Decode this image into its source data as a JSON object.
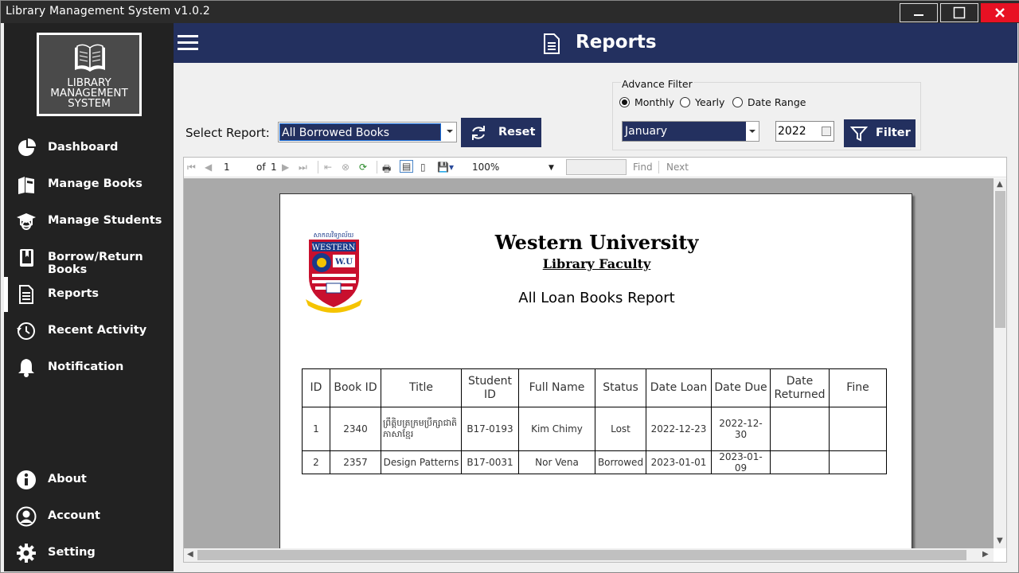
{
  "window": {
    "title": "Library Management System v1.0.2"
  },
  "sidebar": {
    "logo_lines": [
      "LIBRARY",
      "MANAGEMENT",
      "SYSTEM"
    ],
    "items": [
      {
        "label": "Dashboard",
        "icon": "pie-chart-icon"
      },
      {
        "label": "Manage Books",
        "icon": "books-icon"
      },
      {
        "label": "Manage Students",
        "icon": "graduation-cap-icon"
      },
      {
        "label": "Borrow/Return Books",
        "icon": "book-icon"
      },
      {
        "label": "Reports",
        "icon": "document-icon",
        "active": true
      },
      {
        "label": "Recent Activity",
        "icon": "history-icon"
      },
      {
        "label": "Notification",
        "icon": "bell-icon"
      }
    ],
    "bottom_items": [
      {
        "label": "About",
        "icon": "info-icon"
      },
      {
        "label": "Account",
        "icon": "user-icon"
      },
      {
        "label": "Setting",
        "icon": "gear-icon"
      }
    ]
  },
  "header": {
    "title": "Reports"
  },
  "controls": {
    "select_label": "Select Report:",
    "selected_report": "All Borrowed Books",
    "reset_label": "Reset",
    "advance_filter": "Advance Filter",
    "radios": [
      "Monthly",
      "Yearly",
      "Date Range"
    ],
    "radio_selected": "Monthly",
    "month": "January",
    "year": "2022",
    "filter_label": "Filter"
  },
  "toolbar": {
    "page": "1",
    "of_label": "of",
    "total_pages": "1",
    "zoom": "100%",
    "find_label": "Find",
    "next_label": "Next"
  },
  "report": {
    "university": "Western University",
    "faculty": "Library Faculty",
    "title": "All Loan Books Report",
    "seal_text": "WESTERN",
    "seal_abbr": "W.U",
    "columns": [
      "ID",
      "Book ID",
      "Title",
      "Student ID",
      "Full Name",
      "Status",
      "Date Loan",
      "Date Due",
      "Date Returned",
      "Fine"
    ],
    "rows": [
      [
        "1",
        "2340",
        "ព្រឹត្តិបត្រក្រមប្រឹក្សាជាតិភាសាខ្មែរ",
        "B17-0193",
        "Kim Chimy",
        "Lost",
        "2022-12-23",
        "2022-12-30",
        "",
        ""
      ],
      [
        "2",
        "2357",
        "Design Patterns",
        "B17-0031",
        "Nor Vena",
        "Borrowed",
        "2023-01-01",
        "2023-01-09",
        "",
        ""
      ]
    ]
  },
  "colors": {
    "navy": "#23305f",
    "sidebar": "#222222",
    "close": "#e81123"
  }
}
